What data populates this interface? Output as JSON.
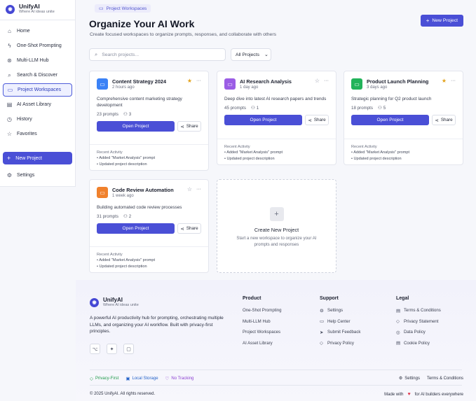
{
  "brand": {
    "name": "UnifyAI",
    "tagline": "Where AI ideas unite"
  },
  "sidebar": {
    "items": [
      {
        "label": "Home",
        "icon": "home-icon"
      },
      {
        "label": "One-Shot Prompting",
        "icon": "bolt-icon"
      },
      {
        "label": "Multi-LLM Hub",
        "icon": "hub-icon"
      },
      {
        "label": "Search & Discover",
        "icon": "search-icon"
      },
      {
        "label": "Project Workspaces",
        "icon": "folder-icon",
        "active": true
      },
      {
        "label": "AI Asset Library",
        "icon": "library-icon"
      },
      {
        "label": "History",
        "icon": "clock-icon"
      },
      {
        "label": "Favorites",
        "icon": "star-icon"
      }
    ],
    "new_project": "New Project",
    "settings": "Settings"
  },
  "header": {
    "breadcrumb": "Project Workspaces",
    "title": "Organize Your AI Work",
    "subtitle": "Create focused workspaces to organize prompts, responses, and collaborate with others",
    "new_project": "New Project"
  },
  "search": {
    "placeholder": "Search projects..."
  },
  "filter": {
    "selected": "All Projects"
  },
  "projects": [
    {
      "name": "Content Strategy 2024",
      "time": "2 hours ago",
      "desc": "Comprehensive content marketing strategy development",
      "prompts": "23 prompts",
      "members": "3",
      "starred": true,
      "color": "#3b82f6"
    },
    {
      "name": "AI Research Analysis",
      "time": "1 day ago",
      "desc": "Deep dive into latest AI research papers and trends",
      "prompts": "45 prompts",
      "members": "1",
      "starred": false,
      "color": "#9b5de5"
    },
    {
      "name": "Product Launch Planning",
      "time": "3 days ago",
      "desc": "Strategic planning for Q2 product launch",
      "prompts": "18 prompts",
      "members": "5",
      "starred": true,
      "color": "#22b35a"
    },
    {
      "name": "Code Review Automation",
      "time": "1 week ago",
      "desc": "Building automated code review processes",
      "prompts": "31 prompts",
      "members": "2",
      "starred": false,
      "color": "#f0812c"
    }
  ],
  "card_labels": {
    "open": "Open Project",
    "share": "Share",
    "recent": "Recent Activity",
    "activity1": "• Added \"Market Analysis\" prompt",
    "activity2": "• Updated project description"
  },
  "create": {
    "title": "Create New Project",
    "desc": "Start a new workspace to organize your AI prompts and responses"
  },
  "footer": {
    "name": "UnifyAI",
    "tagline": "Where AI ideas unite",
    "desc": "A powerful AI productivity hub for prompting, orchestrating multiple LLMs, and organizing your AI workflow. Built with privacy-first principles.",
    "product": {
      "title": "Product",
      "items": [
        "One-Shot Prompting",
        "Multi-LLM Hub",
        "Project Workspaces",
        "AI Asset Library"
      ]
    },
    "support": {
      "title": "Support",
      "items": [
        "Settings",
        "Help Center",
        "Submit Feedback",
        "Privacy Policy"
      ]
    },
    "legal": {
      "title": "Legal",
      "items": [
        "Terms & Conditions",
        "Privacy Statement",
        "Data Policy",
        "Cookie Policy"
      ]
    },
    "badges": [
      {
        "label": "Privacy-First",
        "color": "#1f9a4a"
      },
      {
        "label": "Local Storage",
        "color": "#2563c9"
      },
      {
        "label": "No Tracking",
        "color": "#8b3fd1"
      }
    ],
    "settings": "Settings",
    "terms": "Terms & Conditions",
    "copyright": "© 2025 UnifyAI. All rights reserved.",
    "made_prefix": "Made with",
    "made_suffix": "for AI builders everywhere"
  }
}
